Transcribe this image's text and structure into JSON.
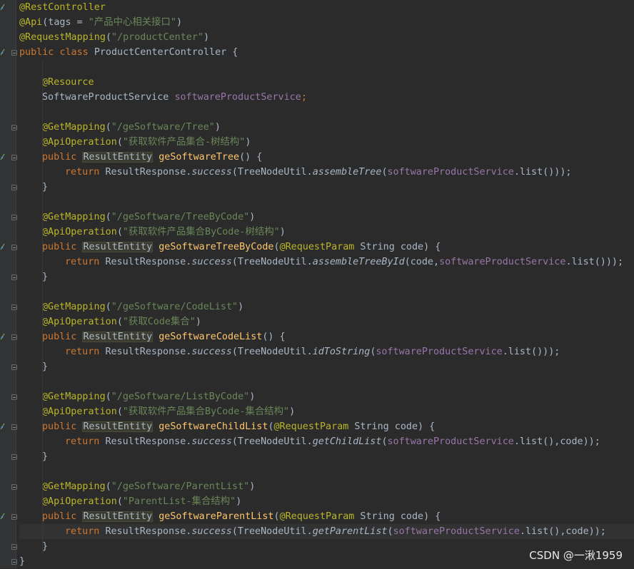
{
  "editor": {
    "lines": [
      [
        {
          "t": "@RestController",
          "c": "annotation"
        }
      ],
      [
        {
          "t": "@Api",
          "c": "annotation"
        },
        {
          "t": "(tags = "
        },
        {
          "t": "\"产品中心相关接口\"",
          "c": "string"
        },
        {
          "t": ")"
        }
      ],
      [
        {
          "t": "@RequestMapping",
          "c": "annotation"
        },
        {
          "t": "("
        },
        {
          "t": "\"/productCenter\"",
          "c": "string"
        },
        {
          "t": ")"
        }
      ],
      [
        {
          "t": "public ",
          "c": "keyword"
        },
        {
          "t": "class ",
          "c": "keyword"
        },
        {
          "t": "ProductCenterController {"
        }
      ],
      [],
      [
        {
          "i": 1
        },
        {
          "t": "@Resource",
          "c": "annotation"
        }
      ],
      [
        {
          "i": 1
        },
        {
          "t": "SoftwareProductService "
        },
        {
          "t": "softwareProductService",
          "c": "field"
        },
        {
          "t": ";",
          "c": "keyword"
        }
      ],
      [],
      [
        {
          "i": 1
        },
        {
          "t": "@GetMapping",
          "c": "annotation"
        },
        {
          "t": "("
        },
        {
          "t": "\"/geSoftware/Tree\"",
          "c": "string"
        },
        {
          "t": ")"
        }
      ],
      [
        {
          "i": 1
        },
        {
          "t": "@ApiOperation",
          "c": "annotation"
        },
        {
          "t": "("
        },
        {
          "t": "\"获取软件产品集合-树结构\"",
          "c": "string"
        },
        {
          "t": ")"
        }
      ],
      [
        {
          "i": 1
        },
        {
          "t": "public ",
          "c": "keyword"
        },
        {
          "t": "ResultEntity",
          "c": "type-hl"
        },
        {
          "t": " "
        },
        {
          "t": "geSoftwareTree",
          "c": "method"
        },
        {
          "t": "() {"
        }
      ],
      [
        {
          "i": 2
        },
        {
          "t": "return ",
          "c": "keyword"
        },
        {
          "t": "ResultResponse."
        },
        {
          "t": "success",
          "c": "static"
        },
        {
          "t": "(TreeNodeUtil."
        },
        {
          "t": "assembleTree",
          "c": "static"
        },
        {
          "t": "("
        },
        {
          "t": "softwareProductService",
          "c": "field"
        },
        {
          "t": ".list()));"
        }
      ],
      [
        {
          "i": 1
        },
        {
          "t": "}"
        }
      ],
      [],
      [
        {
          "i": 1
        },
        {
          "t": "@GetMapping",
          "c": "annotation"
        },
        {
          "t": "("
        },
        {
          "t": "\"/geSoftware/TreeByCode\"",
          "c": "string"
        },
        {
          "t": ")"
        }
      ],
      [
        {
          "i": 1
        },
        {
          "t": "@ApiOperation",
          "c": "annotation"
        },
        {
          "t": "("
        },
        {
          "t": "\"获取软件产品集合ByCode-树结构\"",
          "c": "string"
        },
        {
          "t": ")"
        }
      ],
      [
        {
          "i": 1
        },
        {
          "t": "public ",
          "c": "keyword"
        },
        {
          "t": "ResultEntity",
          "c": "type-hl"
        },
        {
          "t": " "
        },
        {
          "t": "geSoftwareTreeByCode",
          "c": "method"
        },
        {
          "t": "("
        },
        {
          "t": "@RequestParam",
          "c": "annotation"
        },
        {
          "t": " String code) {"
        }
      ],
      [
        {
          "i": 2
        },
        {
          "t": "return ",
          "c": "keyword"
        },
        {
          "t": "ResultResponse."
        },
        {
          "t": "success",
          "c": "static"
        },
        {
          "t": "(TreeNodeUtil."
        },
        {
          "t": "assembleTreeById",
          "c": "static"
        },
        {
          "t": "(code,"
        },
        {
          "t": "softwareProductService",
          "c": "field"
        },
        {
          "t": ".list()));"
        }
      ],
      [
        {
          "i": 1
        },
        {
          "t": "}"
        }
      ],
      [],
      [
        {
          "i": 1
        },
        {
          "t": "@GetMapping",
          "c": "annotation"
        },
        {
          "t": "("
        },
        {
          "t": "\"/geSoftware/CodeList\"",
          "c": "string"
        },
        {
          "t": ")"
        }
      ],
      [
        {
          "i": 1
        },
        {
          "t": "@ApiOperation",
          "c": "annotation"
        },
        {
          "t": "("
        },
        {
          "t": "\"获取Code集合\"",
          "c": "string"
        },
        {
          "t": ")"
        }
      ],
      [
        {
          "i": 1
        },
        {
          "t": "public ",
          "c": "keyword"
        },
        {
          "t": "ResultEntity",
          "c": "type-hl"
        },
        {
          "t": " "
        },
        {
          "t": "geSoftwareCodeList",
          "c": "method"
        },
        {
          "t": "() {"
        }
      ],
      [
        {
          "i": 2
        },
        {
          "t": "return ",
          "c": "keyword"
        },
        {
          "t": "ResultResponse."
        },
        {
          "t": "success",
          "c": "static"
        },
        {
          "t": "(TreeNodeUtil."
        },
        {
          "t": "idToString",
          "c": "static"
        },
        {
          "t": "("
        },
        {
          "t": "softwareProductService",
          "c": "field"
        },
        {
          "t": ".list()));"
        }
      ],
      [
        {
          "i": 1
        },
        {
          "t": "}"
        }
      ],
      [],
      [
        {
          "i": 1
        },
        {
          "t": "@GetMapping",
          "c": "annotation"
        },
        {
          "t": "("
        },
        {
          "t": "\"/geSoftware/ListByCode\"",
          "c": "string"
        },
        {
          "t": ")"
        }
      ],
      [
        {
          "i": 1
        },
        {
          "t": "@ApiOperation",
          "c": "annotation"
        },
        {
          "t": "("
        },
        {
          "t": "\"获取软件产品集合ByCode-集合结构\"",
          "c": "string"
        },
        {
          "t": ")"
        }
      ],
      [
        {
          "i": 1
        },
        {
          "t": "public ",
          "c": "keyword"
        },
        {
          "t": "ResultEntity",
          "c": "type-hl"
        },
        {
          "t": " "
        },
        {
          "t": "geSoftwareChildList",
          "c": "method"
        },
        {
          "t": "("
        },
        {
          "t": "@RequestParam",
          "c": "annotation"
        },
        {
          "t": " String code) {"
        }
      ],
      [
        {
          "i": 2
        },
        {
          "t": "return ",
          "c": "keyword"
        },
        {
          "t": "ResultResponse."
        },
        {
          "t": "success",
          "c": "static"
        },
        {
          "t": "(TreeNodeUtil."
        },
        {
          "t": "getChildList",
          "c": "static"
        },
        {
          "t": "("
        },
        {
          "t": "softwareProductService",
          "c": "field"
        },
        {
          "t": ".list(),code));"
        }
      ],
      [
        {
          "i": 1
        },
        {
          "t": "}"
        }
      ],
      [],
      [
        {
          "i": 1
        },
        {
          "t": "@GetMapping",
          "c": "annotation"
        },
        {
          "t": "("
        },
        {
          "t": "\"/geSoftware/ParentList\"",
          "c": "string"
        },
        {
          "t": ")"
        }
      ],
      [
        {
          "i": 1
        },
        {
          "t": "@ApiOperation",
          "c": "annotation"
        },
        {
          "t": "("
        },
        {
          "t": "\"ParentList-集合结构\"",
          "c": "string"
        },
        {
          "t": ")"
        }
      ],
      [
        {
          "i": 1
        },
        {
          "t": "public ",
          "c": "keyword"
        },
        {
          "t": "ResultEntity",
          "c": "type-hl"
        },
        {
          "t": " "
        },
        {
          "t": "geSoftwareParentList",
          "c": "method"
        },
        {
          "t": "("
        },
        {
          "t": "@RequestParam",
          "c": "annotation"
        },
        {
          "t": " String code) {"
        }
      ],
      [
        {
          "i": 2
        },
        {
          "t": "return ",
          "c": "keyword"
        },
        {
          "t": "ResultResponse."
        },
        {
          "t": "success",
          "c": "static"
        },
        {
          "t": "(TreeNodeUtil."
        },
        {
          "t": "getParentList",
          "c": "static"
        },
        {
          "t": "("
        },
        {
          "t": "softwareProductService",
          "c": "field"
        },
        {
          "t": ".list(),code));"
        }
      ],
      [
        {
          "i": 1
        },
        {
          "t": "}"
        }
      ],
      [
        {
          "t": "}"
        }
      ]
    ],
    "current_line": 35,
    "fold_lines": [
      3,
      8,
      10,
      12,
      14,
      16,
      18,
      20,
      22,
      24,
      26,
      28,
      30,
      32,
      34,
      36,
      37
    ],
    "impl_icon_lines": [
      0,
      3,
      10,
      16,
      22,
      28,
      34
    ]
  },
  "colors": {
    "background": "#2b2b2b",
    "gutter": "#313335",
    "annotation": "#bbb529",
    "keyword": "#cc7832",
    "string": "#6a8759",
    "field": "#9876aa",
    "method": "#ffc66d",
    "text": "#a9b7c6"
  },
  "watermark": "CSDN @一湫1959"
}
